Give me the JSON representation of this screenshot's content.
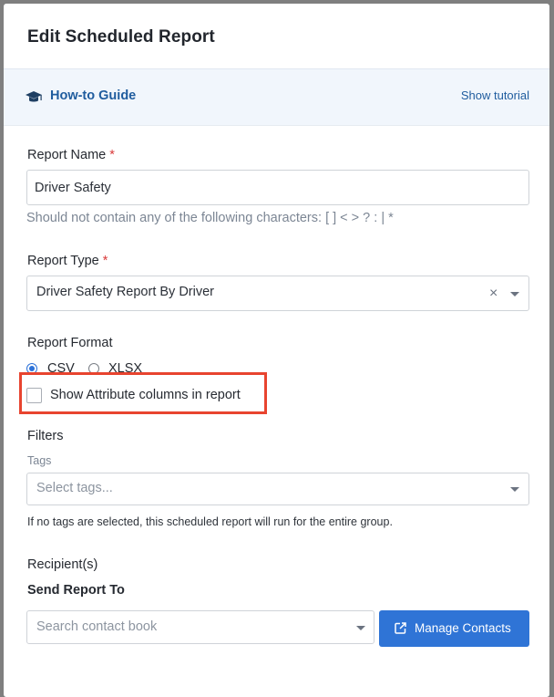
{
  "modal": {
    "title": "Edit Scheduled Report"
  },
  "guide": {
    "icon": "graduation-cap-icon",
    "title": "How-to Guide",
    "tutorial_link": "Show tutorial"
  },
  "report_name": {
    "label": "Report Name",
    "required_mark": "*",
    "value": "Driver Safety",
    "hint": "Should not contain any of the following characters: [ ] < > ? : | *"
  },
  "report_type": {
    "label": "Report Type",
    "required_mark": "*",
    "selected": "Driver Safety Report By Driver",
    "clear_symbol": "×"
  },
  "report_format": {
    "label": "Report Format",
    "options": [
      "CSV",
      "XLSX"
    ],
    "selected": "CSV",
    "attribute_columns_label": "Show Attribute columns in report",
    "attribute_columns_checked": false,
    "highlight_color": "#e8442f"
  },
  "filters": {
    "label": "Filters",
    "tags_label": "Tags",
    "tags_placeholder": "Select tags...",
    "note": "If no tags are selected, this scheduled report will run for the entire group."
  },
  "recipients": {
    "label": "Recipient(s)",
    "send_to_label": "Send Report To",
    "contact_placeholder": "Search contact book",
    "manage_button": "Manage Contacts",
    "manage_icon": "external-link-icon",
    "button_color": "#2f74d6"
  }
}
